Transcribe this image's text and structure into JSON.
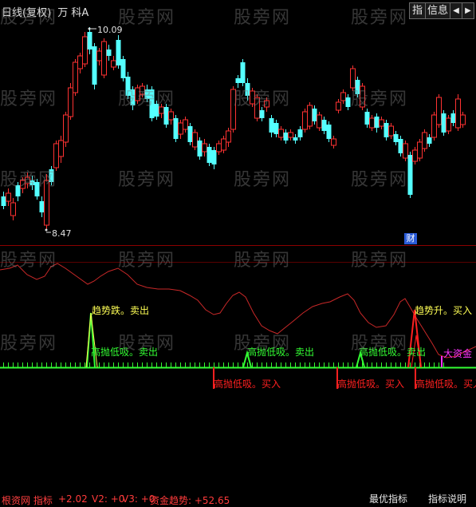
{
  "header": {
    "title": "日线(复权)",
    "title_extra": "万 科A",
    "btn_zhi": "指",
    "btn_info": "信息",
    "btn_prev": "◀",
    "btn_next": "▶"
  },
  "price_chart": {
    "high_label": "10.09",
    "low_label": "8.47",
    "badge": "财"
  },
  "indicator_bar": {
    "name": "根资网 指标",
    "values": [
      {
        "text": "+2.02",
        "color": "#ff3b3b"
      },
      {
        "text": "V2: +0",
        "color": "#ff3b3b"
      },
      {
        "text": "V3: +0",
        "color": "#ff3b3b"
      },
      {
        "text": "资金趋势: +52.65",
        "color": "#ff3b3b"
      }
    ],
    "tab_best": "最优指标",
    "tab_help": "指标说明"
  },
  "signals": {
    "trend_down": "趋势跌。卖出",
    "trend_up": "趋势升。买入",
    "sell_1": "高抛低吸。卖出",
    "sell_2": "高抛低吸。卖出",
    "sell_3": "高抛低吸。卖出",
    "buy_1": "高抛低吸。买入",
    "buy_2": "高抛低吸。买入",
    "buy_3": "高抛低吸。买入",
    "big_fund": "大资金"
  },
  "watermark": "股旁网",
  "colors": {
    "up": "#ff3232",
    "down": "#54ffff",
    "indicator_line": "#c82828",
    "signal_green": "#33ff33",
    "signal_red": "#ff2020",
    "signal_yellow": "#ffff55",
    "signal_magenta": "#ff33ff"
  }
}
